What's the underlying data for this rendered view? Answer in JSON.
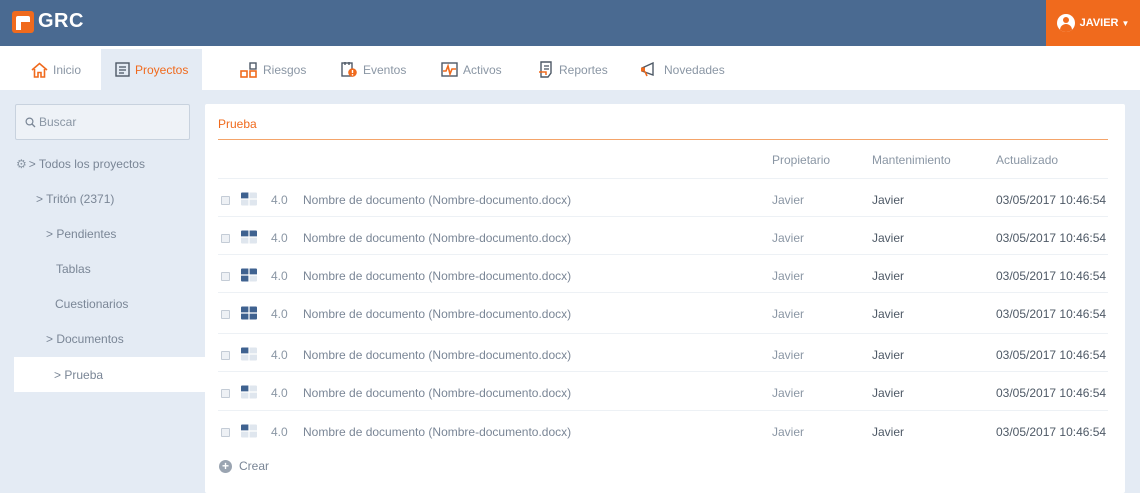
{
  "app": {
    "title": "GRC"
  },
  "user": {
    "name": "JAVIER"
  },
  "nav": {
    "items": [
      {
        "label": "Inicio",
        "icon": "home-icon"
      },
      {
        "label": "Proyectos",
        "icon": "document-icon",
        "active": true
      },
      {
        "label": "Riesgos",
        "icon": "risk-icon"
      },
      {
        "label": "Eventos",
        "icon": "events-icon"
      },
      {
        "label": "Activos",
        "icon": "activity-icon"
      },
      {
        "label": "Reportes",
        "icon": "report-icon"
      },
      {
        "label": "Novedades",
        "icon": "megaphone-icon"
      }
    ]
  },
  "sidebar": {
    "search_placeholder": "Buscar",
    "items": [
      {
        "label": "> Todos los proyectos",
        "icon": "gear-icon"
      },
      {
        "label": "> Tritón (2371)"
      },
      {
        "label": "> Pendientes"
      },
      {
        "label": "Tablas"
      },
      {
        "label": "Cuestionarios"
      },
      {
        "label": "> Documentos"
      },
      {
        "label": "> Prueba",
        "active": true
      }
    ]
  },
  "main": {
    "title": "Prueba",
    "columns": {
      "owner": "Propietario",
      "maintenance": "Mantenimiento",
      "updated": "Actualizado"
    },
    "rows": [
      {
        "status": "quarter-icon",
        "version": "4.0",
        "name": "Nombre de documento (Nombre-documento.docx)",
        "owner": "Javier",
        "maintenance": "Javier",
        "updated": "03/05/2017 10:46:54"
      },
      {
        "status": "half-icon",
        "version": "4.0",
        "name": "Nombre de documento (Nombre-documento.docx)",
        "owner": "Javier",
        "maintenance": "Javier",
        "updated": "03/05/2017 10:46:54"
      },
      {
        "status": "three-quarter-icon",
        "version": "4.0",
        "name": "Nombre de documento (Nombre-documento.docx)",
        "owner": "Javier",
        "maintenance": "Javier",
        "updated": "03/05/2017 10:46:54"
      },
      {
        "status": "full-icon",
        "version": "4.0",
        "name": "Nombre de documento (Nombre-documento.docx)",
        "owner": "Javier",
        "maintenance": "Javier",
        "updated": "03/05/2017 10:46:54"
      },
      {
        "status": "quarter-icon",
        "version": "4.0",
        "name": "Nombre de documento (Nombre-documento.docx)",
        "owner": "Javier",
        "maintenance": "Javier",
        "updated": "03/05/2017 10:46:54"
      },
      {
        "status": "quarter-icon",
        "version": "4.0",
        "name": "Nombre de documento (Nombre-documento.docx)",
        "owner": "Javier",
        "maintenance": "Javier",
        "updated": "03/05/2017 10:46:54"
      },
      {
        "status": "quarter-icon",
        "version": "4.0",
        "name": "Nombre de documento (Nombre-documento.docx)",
        "owner": "Javier",
        "maintenance": "Javier",
        "updated": "03/05/2017 10:46:54"
      }
    ],
    "create_label": "Crear"
  },
  "colors": {
    "accent": "#f06a1d",
    "header": "#4a6a91",
    "background": "#e4ebf4",
    "status": "#3f6290"
  }
}
